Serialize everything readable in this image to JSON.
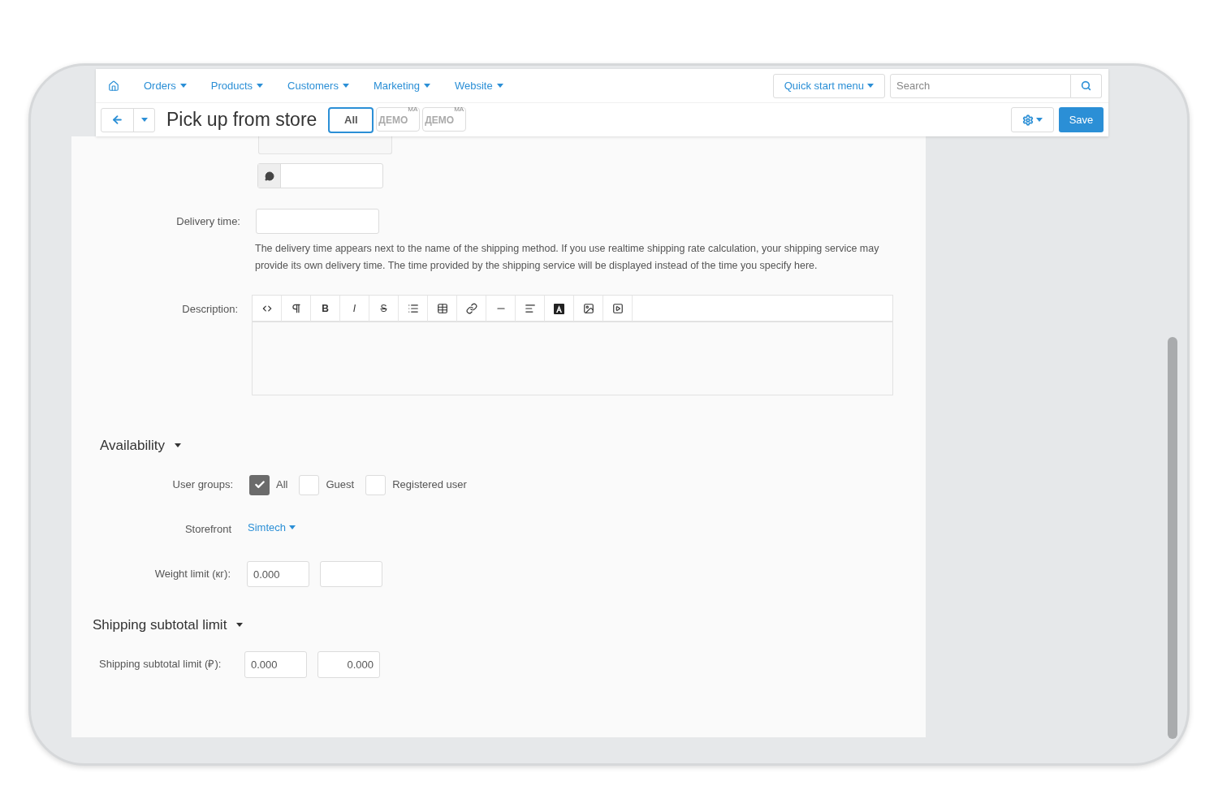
{
  "nav": {
    "menus": [
      {
        "label": "Orders"
      },
      {
        "label": "Products"
      },
      {
        "label": "Customers"
      },
      {
        "label": "Marketing"
      },
      {
        "label": "Website"
      }
    ],
    "quick_start": "Quick start menu",
    "search": {
      "placeholder": "Search"
    }
  },
  "toolbar": {
    "title": "Pick up from store",
    "storefronts": [
      {
        "label": "All",
        "selected": true
      },
      {
        "label": "ДЕМО",
        "sup": "MA",
        "selected": false
      },
      {
        "label": "ДЕМО",
        "sup": "MA",
        "selected": false
      }
    ],
    "save": "Save"
  },
  "delivery": {
    "label": "Delivery time:",
    "help": "The delivery time appears next to the name of the shipping method. If you use realtime shipping rate calculation, your shipping service may provide its own delivery time. The time provided by the shipping service will be displayed instead of the time you specify here."
  },
  "description": {
    "label": "Description:",
    "tools": [
      {
        "kind": "code"
      },
      {
        "kind": "paragraph"
      },
      {
        "kind": "text",
        "label": "B"
      },
      {
        "kind": "italic",
        "label": "I"
      },
      {
        "kind": "strike",
        "label": "S"
      },
      {
        "kind": "list"
      },
      {
        "kind": "table"
      },
      {
        "kind": "link"
      },
      {
        "kind": "rule"
      },
      {
        "kind": "align"
      },
      {
        "kind": "font-color"
      },
      {
        "kind": "image"
      },
      {
        "kind": "video"
      }
    ]
  },
  "availability": {
    "heading": "Availability",
    "expanded": true,
    "user_groups_label": "User groups:",
    "user_groups": [
      {
        "label": "All",
        "checked": true
      },
      {
        "label": "Guest",
        "checked": false
      },
      {
        "label": "Registered user",
        "checked": false
      }
    ],
    "storefront_label": "Storefront",
    "storefront_value": "Simtech",
    "weight_label": "Weight limit (кг):",
    "weight_from": "0.000"
  },
  "subtotal": {
    "heading": "Shipping subtotal limit",
    "expanded": true,
    "label": "Shipping subtotal limit (₽):",
    "from": "0.000",
    "to": "0.000"
  }
}
